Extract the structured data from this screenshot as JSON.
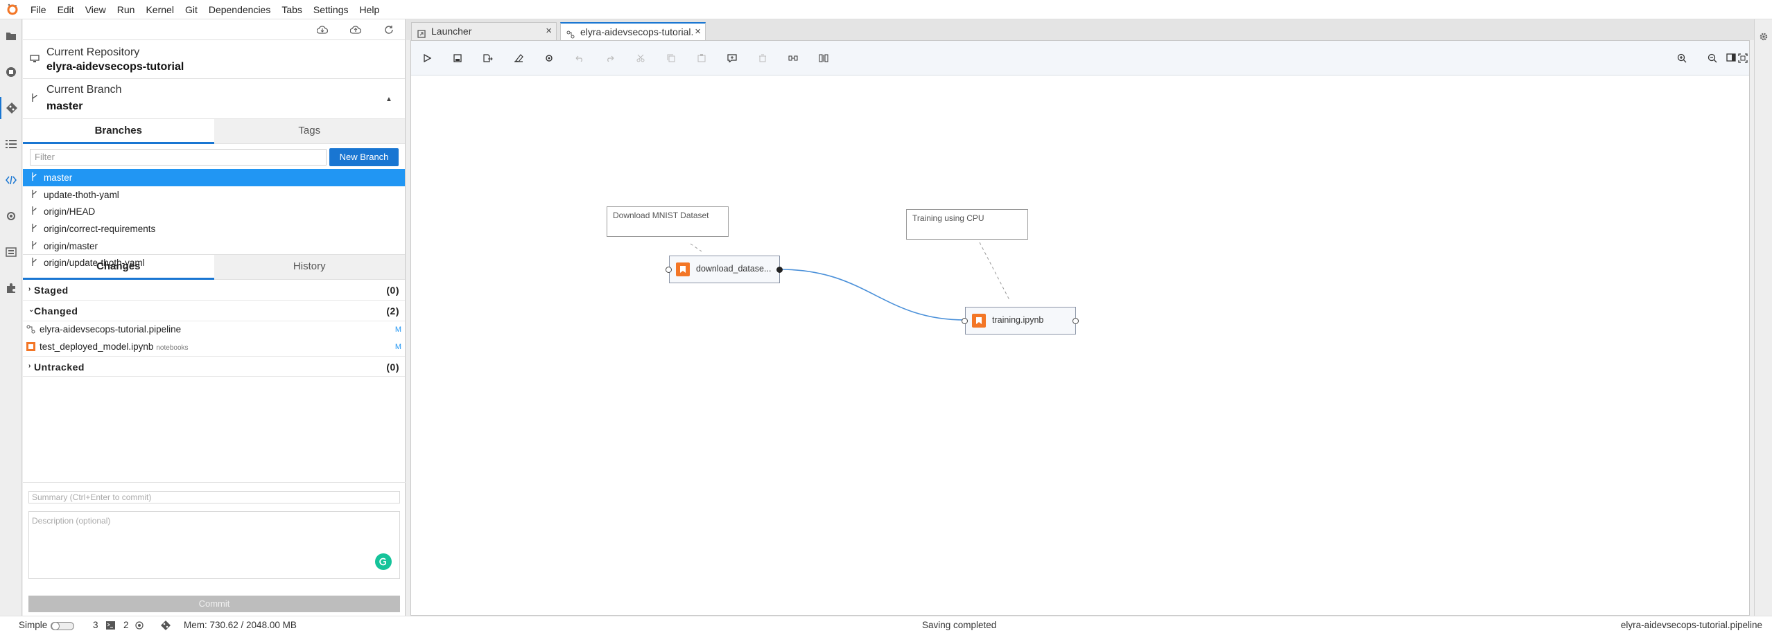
{
  "menu": [
    "File",
    "Edit",
    "View",
    "Run",
    "Kernel",
    "Git",
    "Dependencies",
    "Tabs",
    "Settings",
    "Help"
  ],
  "git_panel": {
    "repo_label": "Current Repository",
    "repo_name": "elyra-aidevsecops-tutorial",
    "branch_label": "Current Branch",
    "branch_name": "master",
    "tabs": [
      "Branches",
      "Tags"
    ],
    "filter_placeholder": "Filter",
    "new_branch_label": "New Branch",
    "branches": [
      "master",
      "update-thoth-yaml",
      "origin/HEAD",
      "origin/correct-requirements",
      "origin/master",
      "origin/update-thoth-yaml"
    ],
    "change_tabs": [
      "Changes",
      "History"
    ],
    "staged": {
      "label": "Staged",
      "count": "(0)"
    },
    "changed": {
      "label": "Changed",
      "count": "(2)"
    },
    "untracked": {
      "label": "Untracked",
      "count": "(0)"
    },
    "changed_files": [
      {
        "name": "elyra-aidevsecops-tutorial.pipeline",
        "path": "",
        "status": "M",
        "icon": "pipeline-icon"
      },
      {
        "name": "test_deployed_model.ipynb",
        "path": "notebooks",
        "status": "M",
        "icon": "notebook-icon"
      }
    ],
    "summary_placeholder": "Summary (Ctrl+Enter to commit)",
    "description_placeholder": "Description (optional)",
    "commit_label": "Commit"
  },
  "doc_tabs": [
    {
      "label": "Launcher",
      "active": false
    },
    {
      "label": "elyra-aidevsecops-tutorial.p",
      "active": true
    }
  ],
  "pipeline": {
    "comments": [
      "Download MNIST Dataset",
      "Training using CPU"
    ],
    "nodes": [
      "download_datase...",
      "training.ipynb"
    ]
  },
  "status": {
    "mode_label": "Simple",
    "terminals": "3",
    "kernels": "2",
    "memory": "Mem: 730.62 / 2048.00 MB",
    "message": "Saving completed",
    "filename": "elyra-aidevsecops-tutorial.pipeline"
  },
  "colors": {
    "accent": "#1976d2",
    "selected": "#2196f3",
    "notebook": "#f37626"
  }
}
